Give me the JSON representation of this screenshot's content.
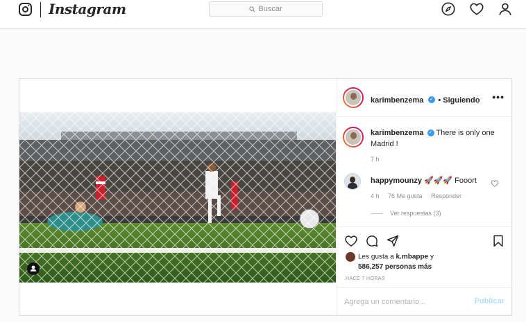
{
  "nav": {
    "brand": "Instagram",
    "search_placeholder": "Buscar",
    "icons": [
      "instagram-glyph-icon",
      "search-icon",
      "compass-icon",
      "heart-icon",
      "profile-icon"
    ]
  },
  "post": {
    "author": "karimbenzema",
    "verified": true,
    "follow_status": "• Siguiendo",
    "more_icon": "more-options-icon",
    "caption": {
      "author": "karimbenzema",
      "text": "There is only one Madrid !",
      "time": "7 h"
    },
    "comments": [
      {
        "author": "happymounzy",
        "text": "🚀🚀🚀 Fooort",
        "time": "4 h",
        "likes": "76 Me gusta",
        "reply_label": "Responder",
        "view_replies": "Ver respuestas (3)"
      }
    ],
    "liked_by": {
      "prefix": "Les gusta a",
      "user": "k.mbappe",
      "joiner": "y",
      "count_text": "586,257 personas más"
    },
    "posted_ago": "HACE 7 HORAS",
    "comment_placeholder": "Agrega un comentario...",
    "publish_label": "Publicar",
    "colors": {
      "accent_blue": "#3897f0",
      "publish_disabled": "#b2dffc",
      "border": "#dbdbdb"
    }
  }
}
